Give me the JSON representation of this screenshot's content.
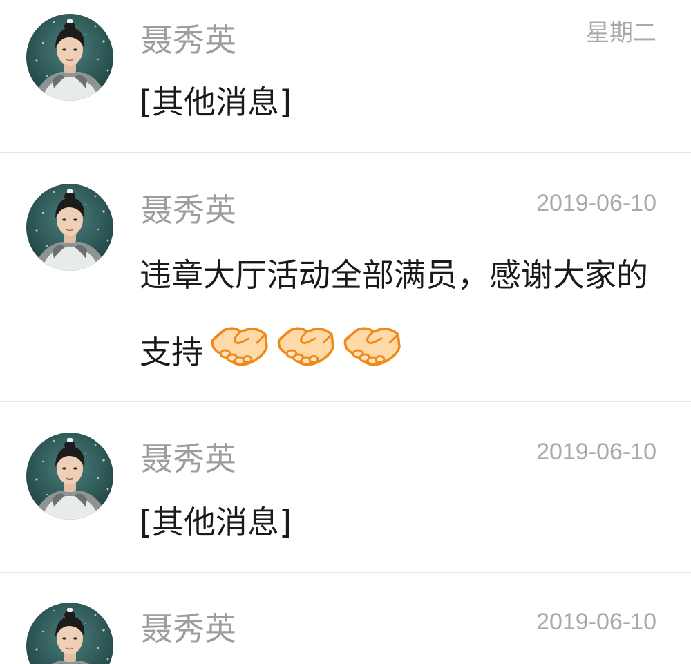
{
  "conversations": [
    {
      "sender": "聂秀英",
      "time": "星期二",
      "message": "[其他消息]"
    },
    {
      "sender": "聂秀英",
      "time": "2019-06-10",
      "message": "违章大厅活动全部满员，感谢大家的支持",
      "emoji": [
        "handshake-emoji",
        "handshake-emoji",
        "handshake-emoji"
      ]
    },
    {
      "sender": "聂秀英",
      "time": "2019-06-10",
      "message": "[其他消息]"
    },
    {
      "sender": "聂秀英",
      "time": "2019-06-10",
      "message": ""
    }
  ],
  "colors": {
    "sender_name": "#9d9d9d",
    "timestamp": "#a9a9a9",
    "message_text": "#1a1a1a",
    "divider": "#e5e5e5",
    "handshake_fill": "#ffd9a8",
    "handshake_outline": "#ef8a1a"
  },
  "icons": {
    "avatar": "profile-photo"
  }
}
